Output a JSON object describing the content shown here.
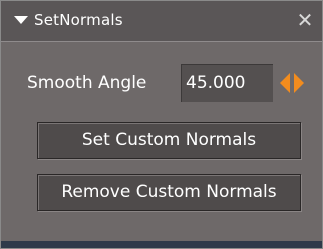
{
  "window": {
    "title": "SetNormals",
    "close_glyph": "✕"
  },
  "params": {
    "smooth_angle_label": "Smooth Angle",
    "smooth_angle_value": "45.000"
  },
  "buttons": {
    "set_custom_normals": "Set Custom Normals",
    "remove_custom_normals": "Remove Custom Normals"
  },
  "colors": {
    "spinner_accent": "#f28c1e",
    "panel_bg": "#6e6969",
    "titlebar_bg": "#5a5657"
  },
  "icons": {
    "collapse": "triangle-down-icon",
    "close": "close-icon",
    "spinner": "left-right-arrows-icon"
  }
}
